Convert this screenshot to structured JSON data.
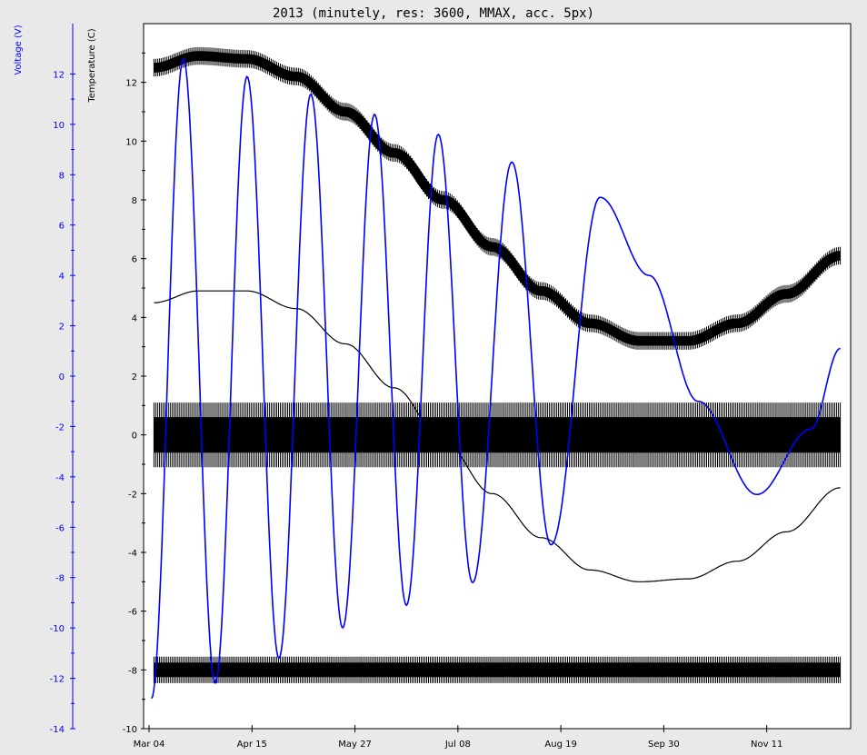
{
  "chart_data": {
    "type": "line",
    "title": "2013 (minutely, res: 3600, MMAX, acc. 5px)",
    "x_tick_labels": [
      "Mar 04",
      "Apr 15",
      "May 27",
      "Jul 08",
      "Aug 19",
      "Sep 30",
      "Nov 11"
    ],
    "x_tick_days": [
      0,
      42,
      84,
      126,
      168,
      210,
      252
    ],
    "x_range_days": [
      0,
      284
    ],
    "left_axis": {
      "label": "Voltage (V)",
      "color": "#0000ff",
      "ticks": [
        -14,
        -12,
        -10,
        -8,
        -6,
        -4,
        -2,
        0,
        2,
        4,
        6,
        8,
        10,
        12
      ],
      "range": [
        -14,
        14
      ]
    },
    "right_axis": {
      "label": "Temperature (C)",
      "color": "#000000",
      "ticks": [
        -10,
        -8,
        -6,
        -4,
        -2,
        0,
        2,
        4,
        6,
        8,
        10,
        12
      ],
      "range": [
        -10,
        14
      ]
    },
    "series": [
      {
        "axis": "temperature",
        "color": "#000000",
        "style": "thick-band",
        "x": [
          2,
          20,
          40,
          60,
          80,
          100,
          120,
          140,
          160,
          180,
          200,
          220,
          240,
          260,
          282
        ],
        "y": [
          12.5,
          12.9,
          12.8,
          12.2,
          11.0,
          9.6,
          8.0,
          6.4,
          4.9,
          3.8,
          3.2,
          3.2,
          3.8,
          4.8,
          6.1
        ],
        "half_width": 0.3
      },
      {
        "axis": "temperature",
        "color": "#000000",
        "style": "thick-band",
        "x": [
          2,
          282
        ],
        "y": [
          0,
          0
        ],
        "half_width": 1.1
      },
      {
        "axis": "temperature",
        "color": "#000000",
        "style": "thick-band",
        "x": [
          2,
          282
        ],
        "y": [
          -8,
          -8
        ],
        "half_width": 0.45
      },
      {
        "axis": "temperature",
        "color": "#000000",
        "style": "line",
        "x": [
          2,
          20,
          40,
          60,
          80,
          100,
          120,
          140,
          160,
          180,
          200,
          220,
          240,
          260,
          282
        ],
        "y": [
          4.5,
          4.9,
          4.9,
          4.3,
          3.1,
          1.6,
          -0.2,
          -2.0,
          -3.5,
          -4.6,
          -5.0,
          -4.9,
          -4.3,
          -3.3,
          -1.8
        ]
      },
      {
        "axis": "voltage",
        "color": "#0000ff",
        "style": "line",
        "x": [
          1,
          14,
          27,
          40,
          53,
          66,
          79,
          92,
          105,
          118,
          132,
          148,
          164,
          184,
          204,
          224,
          248,
          270,
          282
        ],
        "y": [
          -12.8,
          12.6,
          -12.2,
          11.9,
          -11.2,
          11.2,
          -10.0,
          10.4,
          -9.1,
          9.6,
          -8.2,
          8.5,
          -6.7,
          7.1,
          4.0,
          -1.0,
          -4.7,
          -2.1,
          1.1
        ]
      }
    ],
    "grid": false,
    "legend": "none"
  }
}
